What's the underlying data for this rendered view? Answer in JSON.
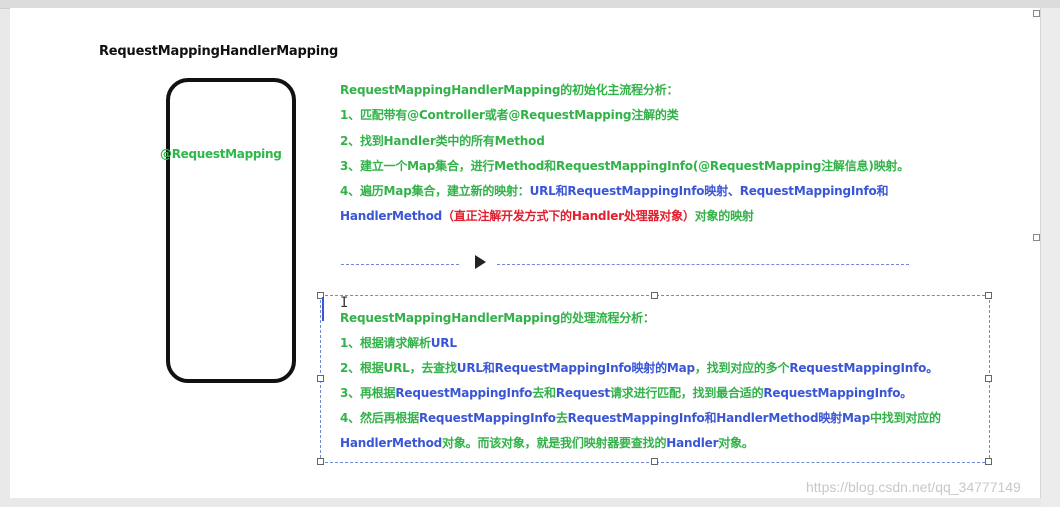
{
  "diagram_title": "RequestMappingHandlerMapping",
  "box_label": "@RequestMapping",
  "init_section": {
    "heading": "RequestMappingHandlerMapping的初始化主流程分析：",
    "step1": "1、匹配带有@Controller或者@RequestMapping注解的类",
    "step2": "2、找到Handler类中的所有Method",
    "step3": "3、建立一个Map集合，进行Method和RequestMappingInfo(@RequestMapping注解信息)映射。",
    "step4_prefix": "4、遍历Map集合，建立新的映射：",
    "step4_blue": "URL和RequestMappingInfo映射、RequestMappingInfo和",
    "step4_line2_blue": "HandlerMethod",
    "step4_line2_red": "（直正注解开发方式下的Handler处理器对象）",
    "step4_line2_tail": "对象的映射"
  },
  "process_section": {
    "heading": "RequestMappingHandlerMapping的处理流程分析：",
    "step1_a": "1、根据请求解析",
    "step1_b": "URL",
    "step2_a": "2、根据URL，去查找",
    "step2_b": "URL和RequestMappingInfo映射的Map",
    "step2_c": "，找到对应的多个",
    "step2_d": "RequestMappingInfo。",
    "step3_a": "3、再根据",
    "step3_b": "RequestMappingInfo",
    "step3_c": "去和",
    "step3_d": "Request",
    "step3_e": "请求进行匹配，找到最合适的",
    "step3_f": "RequestMappingInfo。",
    "step4_a": "4、然后再根据",
    "step4_b": "RequestMappingInfo",
    "step4_c": "去",
    "step4_d": "RequestMappingInfo和HandlerMethod映射Map",
    "step4_e": "中找到对应的",
    "step4_line2_a": "HandlerMethod",
    "step4_line2_b": "对象。而该对象，就是我们映射器要查找的",
    "step4_line2_c": "Handler",
    "step4_line2_d": "对象。"
  },
  "watermark": "https://blog.csdn.net/qq_34777149",
  "colors": {
    "green": "#33b24a",
    "blue": "#3a56d6",
    "red": "#e0202e"
  }
}
